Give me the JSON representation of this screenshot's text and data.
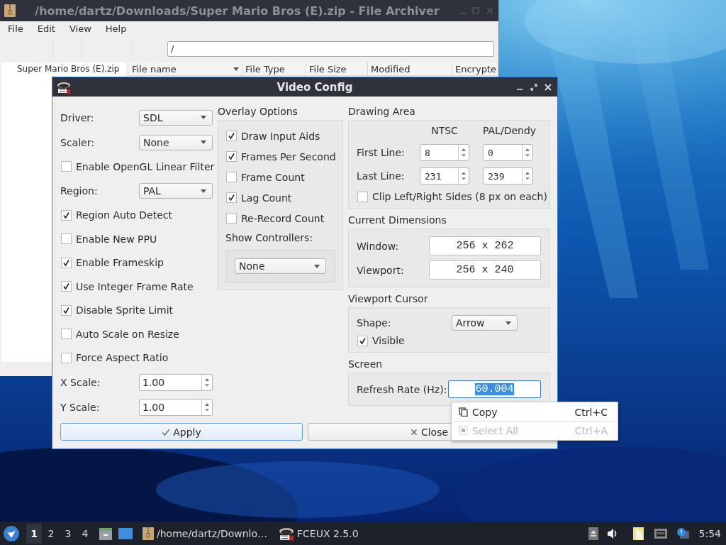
{
  "archiver": {
    "title": "/home/dartz/Downloads/Super Mario Bros (E).zip - File Archiver",
    "menu": [
      "File",
      "Edit",
      "View",
      "Help"
    ],
    "path": "/",
    "tree": [
      "Super Mario Bros (E).zip"
    ],
    "columns": [
      {
        "label": "File name",
        "sorted": true
      },
      {
        "label": "File Type",
        "sorted": false
      },
      {
        "label": "File Size",
        "sorted": false
      },
      {
        "label": "Modified",
        "sorted": false
      },
      {
        "label": "Encrypte",
        "sorted": false
      }
    ]
  },
  "video_config": {
    "title": "Video Config",
    "options": [
      {
        "kind": "combo",
        "label": "Driver:",
        "value": "SDL"
      },
      {
        "kind": "combo",
        "label": "Scaler:",
        "value": "None"
      },
      {
        "kind": "check",
        "label": "Enable OpenGL Linear Filter",
        "checked": false
      },
      {
        "kind": "combo",
        "label": "Region:",
        "value": "PAL"
      },
      {
        "kind": "check",
        "label": "Region Auto Detect",
        "checked": true
      },
      {
        "kind": "check",
        "label": "Enable New PPU",
        "checked": false
      },
      {
        "kind": "check",
        "label": "Enable Frameskip",
        "checked": true
      },
      {
        "kind": "check",
        "label": "Use Integer Frame Rate",
        "checked": true
      },
      {
        "kind": "check",
        "label": "Disable Sprite Limit",
        "checked": true
      },
      {
        "kind": "check",
        "label": "Auto Scale on Resize",
        "checked": false
      },
      {
        "kind": "check",
        "label": "Force Aspect Ratio",
        "checked": false
      },
      {
        "kind": "spin",
        "label": "X Scale:",
        "value": "1.00"
      },
      {
        "kind": "spin",
        "label": "Y Scale:",
        "value": "1.00"
      }
    ],
    "overlay": {
      "title": "Overlay Options",
      "checks": [
        {
          "label": "Draw Input Aids",
          "checked": true
        },
        {
          "label": "Frames Per Second",
          "checked": true
        },
        {
          "label": "Frame Count",
          "checked": false
        },
        {
          "label": "Lag Count",
          "checked": true
        },
        {
          "label": "Re-Record Count",
          "checked": false
        }
      ],
      "controllers_label": "Show Controllers:",
      "controllers_value": "None"
    },
    "drawing_area": {
      "title": "Drawing Area",
      "headers": [
        "NTSC",
        "PAL/Dendy"
      ],
      "rows": [
        {
          "label": "First Line:",
          "ntsc": "8",
          "pal": "0"
        },
        {
          "label": "Last Line:",
          "ntsc": "231",
          "pal": "239"
        }
      ],
      "clip": {
        "label": "Clip Left/Right Sides (8 px on each)",
        "checked": false
      }
    },
    "dimensions": {
      "title": "Current Dimensions",
      "rows": [
        {
          "label": "Window:",
          "value": "256 x 262"
        },
        {
          "label": "Viewport:",
          "value": "256 x 240"
        }
      ]
    },
    "cursor": {
      "title": "Viewport Cursor",
      "shape_label": "Shape:",
      "shape": "Arrow",
      "visible": {
        "label": "Visible",
        "checked": true
      }
    },
    "screen": {
      "title": "Screen",
      "refresh_label": "Refresh Rate (Hz):",
      "refresh": "60.004",
      "refresh_selected": true
    },
    "buttons": [
      {
        "kind": "apply",
        "label": "Apply"
      },
      {
        "kind": "close",
        "label": "Close"
      }
    ]
  },
  "context_menu": [
    {
      "kind": "copy",
      "label": "Copy",
      "shortcut": "Ctrl+C",
      "disabled": false
    },
    {
      "kind": "select_all",
      "label": "Select All",
      "shortcut": "Ctrl+A",
      "disabled": true
    }
  ],
  "taskbar": {
    "workspaces": [
      {
        "label": "1",
        "selected": true
      },
      {
        "label": "2",
        "selected": false
      },
      {
        "label": "3",
        "selected": false
      },
      {
        "label": "4",
        "selected": false
      }
    ],
    "tasks": [
      {
        "kind": "archive",
        "label": "/home/dartz/Downlo…"
      },
      {
        "kind": "fceux",
        "label": "FCEUX 2.5.0"
      }
    ],
    "clock": "5:54"
  }
}
